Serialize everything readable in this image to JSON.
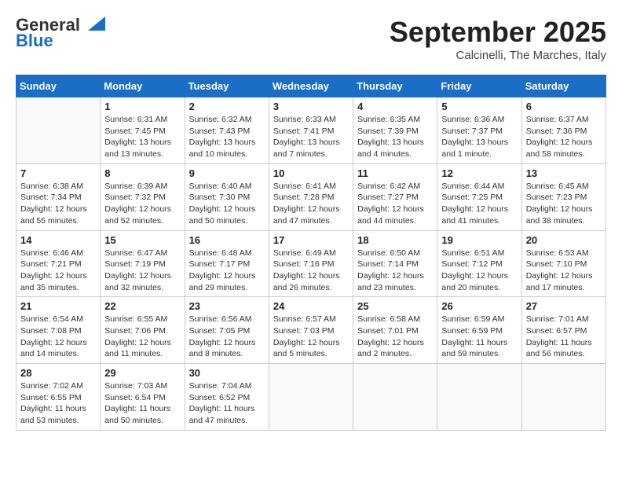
{
  "header": {
    "logo_line1": "General",
    "logo_line2": "Blue",
    "month": "September 2025",
    "location": "Calcinelli, The Marches, Italy"
  },
  "days_of_week": [
    "Sunday",
    "Monday",
    "Tuesday",
    "Wednesday",
    "Thursday",
    "Friday",
    "Saturday"
  ],
  "weeks": [
    [
      {
        "date": "",
        "info": ""
      },
      {
        "date": "1",
        "info": "Sunrise: 6:31 AM\nSunset: 7:45 PM\nDaylight: 13 hours\nand 13 minutes."
      },
      {
        "date": "2",
        "info": "Sunrise: 6:32 AM\nSunset: 7:43 PM\nDaylight: 13 hours\nand 10 minutes."
      },
      {
        "date": "3",
        "info": "Sunrise: 6:33 AM\nSunset: 7:41 PM\nDaylight: 13 hours\nand 7 minutes."
      },
      {
        "date": "4",
        "info": "Sunrise: 6:35 AM\nSunset: 7:39 PM\nDaylight: 13 hours\nand 4 minutes."
      },
      {
        "date": "5",
        "info": "Sunrise: 6:36 AM\nSunset: 7:37 PM\nDaylight: 13 hours\nand 1 minute."
      },
      {
        "date": "6",
        "info": "Sunrise: 6:37 AM\nSunset: 7:36 PM\nDaylight: 12 hours\nand 58 minutes."
      }
    ],
    [
      {
        "date": "7",
        "info": "Sunrise: 6:38 AM\nSunset: 7:34 PM\nDaylight: 12 hours\nand 55 minutes."
      },
      {
        "date": "8",
        "info": "Sunrise: 6:39 AM\nSunset: 7:32 PM\nDaylight: 12 hours\nand 52 minutes."
      },
      {
        "date": "9",
        "info": "Sunrise: 6:40 AM\nSunset: 7:30 PM\nDaylight: 12 hours\nand 50 minutes."
      },
      {
        "date": "10",
        "info": "Sunrise: 6:41 AM\nSunset: 7:28 PM\nDaylight: 12 hours\nand 47 minutes."
      },
      {
        "date": "11",
        "info": "Sunrise: 6:42 AM\nSunset: 7:27 PM\nDaylight: 12 hours\nand 44 minutes."
      },
      {
        "date": "12",
        "info": "Sunrise: 6:44 AM\nSunset: 7:25 PM\nDaylight: 12 hours\nand 41 minutes."
      },
      {
        "date": "13",
        "info": "Sunrise: 6:45 AM\nSunset: 7:23 PM\nDaylight: 12 hours\nand 38 minutes."
      }
    ],
    [
      {
        "date": "14",
        "info": "Sunrise: 6:46 AM\nSunset: 7:21 PM\nDaylight: 12 hours\nand 35 minutes."
      },
      {
        "date": "15",
        "info": "Sunrise: 6:47 AM\nSunset: 7:19 PM\nDaylight: 12 hours\nand 32 minutes."
      },
      {
        "date": "16",
        "info": "Sunrise: 6:48 AM\nSunset: 7:17 PM\nDaylight: 12 hours\nand 29 minutes."
      },
      {
        "date": "17",
        "info": "Sunrise: 6:49 AM\nSunset: 7:16 PM\nDaylight: 12 hours\nand 26 minutes."
      },
      {
        "date": "18",
        "info": "Sunrise: 6:50 AM\nSunset: 7:14 PM\nDaylight: 12 hours\nand 23 minutes."
      },
      {
        "date": "19",
        "info": "Sunrise: 6:51 AM\nSunset: 7:12 PM\nDaylight: 12 hours\nand 20 minutes."
      },
      {
        "date": "20",
        "info": "Sunrise: 6:53 AM\nSunset: 7:10 PM\nDaylight: 12 hours\nand 17 minutes."
      }
    ],
    [
      {
        "date": "21",
        "info": "Sunrise: 6:54 AM\nSunset: 7:08 PM\nDaylight: 12 hours\nand 14 minutes."
      },
      {
        "date": "22",
        "info": "Sunrise: 6:55 AM\nSunset: 7:06 PM\nDaylight: 12 hours\nand 11 minutes."
      },
      {
        "date": "23",
        "info": "Sunrise: 6:56 AM\nSunset: 7:05 PM\nDaylight: 12 hours\nand 8 minutes."
      },
      {
        "date": "24",
        "info": "Sunrise: 6:57 AM\nSunset: 7:03 PM\nDaylight: 12 hours\nand 5 minutes."
      },
      {
        "date": "25",
        "info": "Sunrise: 6:58 AM\nSunset: 7:01 PM\nDaylight: 12 hours\nand 2 minutes."
      },
      {
        "date": "26",
        "info": "Sunrise: 6:59 AM\nSunset: 6:59 PM\nDaylight: 11 hours\nand 59 minutes."
      },
      {
        "date": "27",
        "info": "Sunrise: 7:01 AM\nSunset: 6:57 PM\nDaylight: 11 hours\nand 56 minutes."
      }
    ],
    [
      {
        "date": "28",
        "info": "Sunrise: 7:02 AM\nSunset: 6:55 PM\nDaylight: 11 hours\nand 53 minutes."
      },
      {
        "date": "29",
        "info": "Sunrise: 7:03 AM\nSunset: 6:54 PM\nDaylight: 11 hours\nand 50 minutes."
      },
      {
        "date": "30",
        "info": "Sunrise: 7:04 AM\nSunset: 6:52 PM\nDaylight: 11 hours\nand 47 minutes."
      },
      {
        "date": "",
        "info": ""
      },
      {
        "date": "",
        "info": ""
      },
      {
        "date": "",
        "info": ""
      },
      {
        "date": "",
        "info": ""
      }
    ]
  ]
}
